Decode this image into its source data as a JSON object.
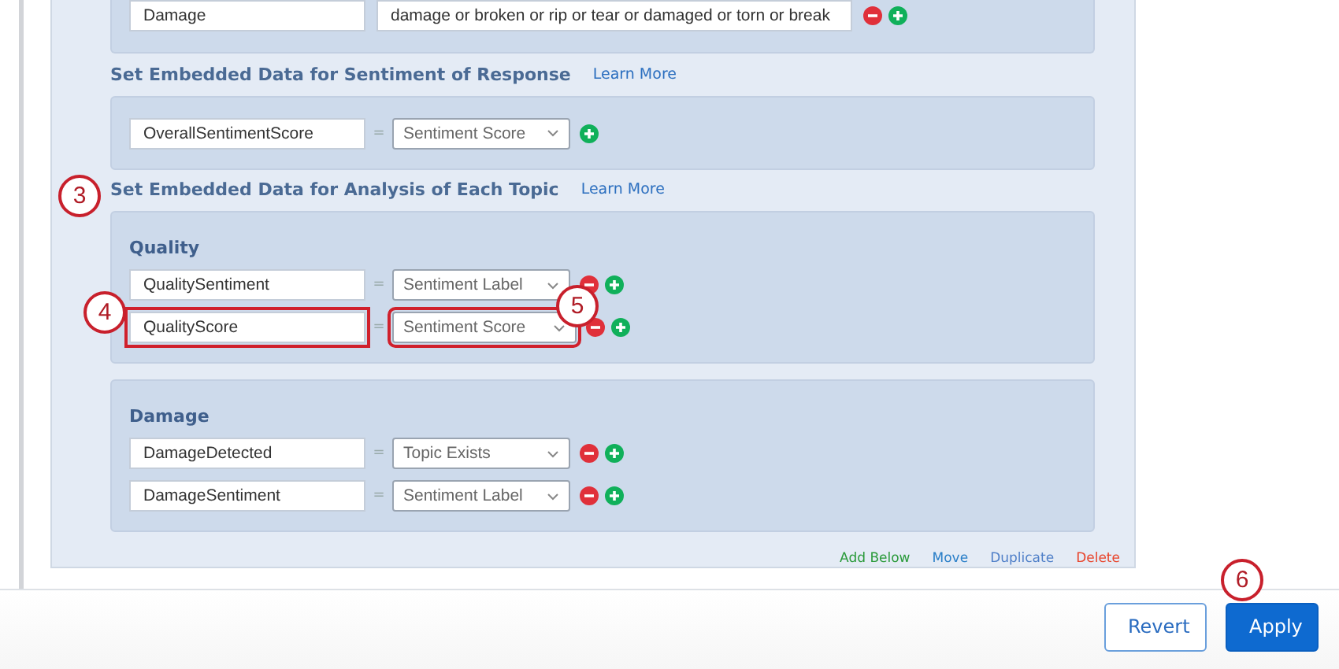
{
  "keyword_rows": [
    {
      "topic": "Damage",
      "keywords": "damage or broken or rip or tear or damaged or torn or break",
      "removable": true
    }
  ],
  "sections": [
    {
      "title": "Set Embedded Data for Sentiment of Response",
      "link": "Learn More",
      "groups": [
        {
          "rows": [
            {
              "field": "OverallSentimentScore",
              "equals": "=",
              "value": "Sentiment Score",
              "removable": false
            }
          ]
        }
      ]
    },
    {
      "title": "Set Embedded Data for Analysis of Each Topic",
      "link": "Learn More",
      "callout": "3",
      "groups": [
        {
          "heading": "Quality",
          "rows": [
            {
              "field": "QualitySentiment",
              "equals": "=",
              "value": "Sentiment Label",
              "removable": true
            },
            {
              "field": "QualityScore",
              "equals": "=",
              "value": "Sentiment Score",
              "removable": true,
              "field_callout": "4",
              "value_callout": "5"
            }
          ]
        },
        {
          "heading": "Damage",
          "rows": [
            {
              "field": "DamageDetected",
              "equals": "=",
              "value": "Topic Exists",
              "removable": true
            },
            {
              "field": "DamageSentiment",
              "equals": "=",
              "value": "Sentiment Label",
              "removable": true
            }
          ]
        }
      ]
    }
  ],
  "actions": [
    {
      "label": "Add Below",
      "kind": "add"
    },
    {
      "label": "Move",
      "kind": "move"
    },
    {
      "label": "Duplicate",
      "kind": "duplicate"
    },
    {
      "label": "Delete",
      "kind": "delete"
    }
  ],
  "footer": {
    "buttons": [
      {
        "label": "Revert",
        "kind": "secondary"
      },
      {
        "label": "Apply",
        "kind": "primary",
        "callout": "6"
      }
    ]
  }
}
